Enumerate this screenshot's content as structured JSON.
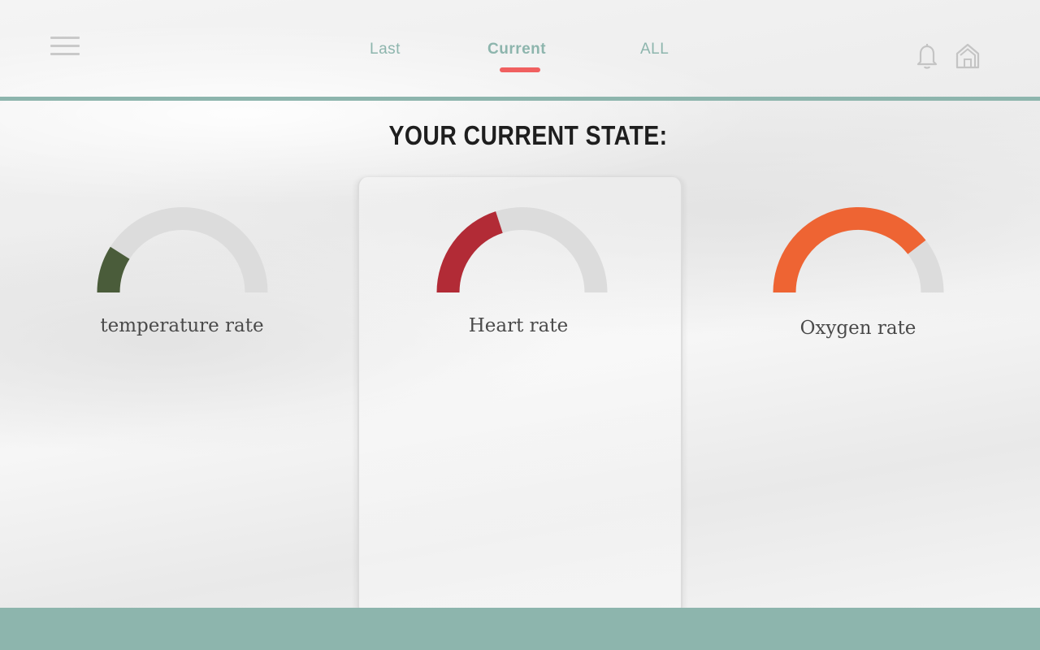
{
  "nav": {
    "tabs": [
      {
        "label": "Last",
        "active": false
      },
      {
        "label": "Current",
        "active": true
      },
      {
        "label": "ALL",
        "active": false
      }
    ],
    "menu_icon": "hamburger-menu-icon",
    "notification_icon": "bell-icon",
    "home_icon": "home-icon"
  },
  "title": "YOUR CURRENT STATE:",
  "gauges": [
    {
      "label": "temperature rate",
      "value": 0.18,
      "color": "#4a5c3a"
    },
    {
      "label": "Heart rate",
      "value": 0.4,
      "color": "#b22b36"
    },
    {
      "label": "Oxygen rate",
      "value": 0.79,
      "color": "#ee6433"
    }
  ],
  "colors": {
    "accent": "#8db5ad",
    "indicator": "#f06060",
    "track": "#dcdcdc"
  }
}
